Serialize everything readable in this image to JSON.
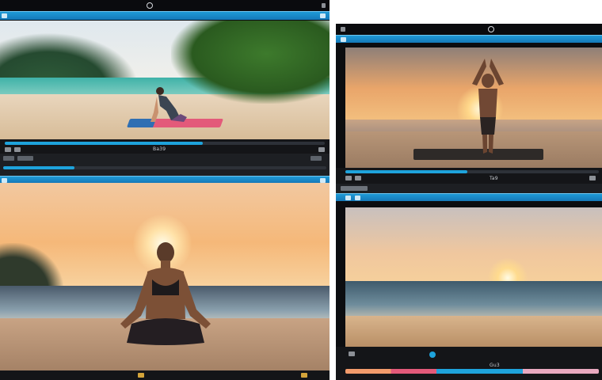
{
  "colors": {
    "accent": "#1ea3dc",
    "window_bg": "#0c0d10",
    "mat_pink": "#e35a7a",
    "mat_blue": "#2f6fb3"
  },
  "windows": [
    {
      "id": "tl",
      "scene": "beach-yoga-mat",
      "caption": "Ba39",
      "progress": 0.62
    },
    {
      "id": "tr",
      "scene": "beach-sunset-standing-pose",
      "caption": "Ta9",
      "progress": 0.48
    },
    {
      "id": "bl",
      "scene": "beach-sunset-meditation",
      "caption": "",
      "progress": 0.0
    },
    {
      "id": "br",
      "scene": "beach-sunset-ocean",
      "caption": "Gu3",
      "progress": 0.0
    }
  ],
  "icons": {
    "camera": "camera-icon",
    "play": "play-icon",
    "settings": "gear-icon",
    "volume": "volume-icon",
    "fullscreen": "fullscreen-icon"
  }
}
